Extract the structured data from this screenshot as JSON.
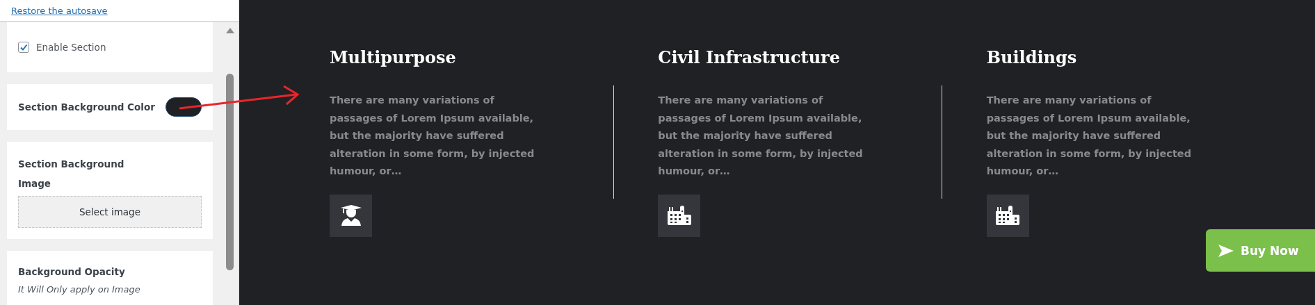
{
  "sidebar": {
    "restore_link": "Restore the autosave",
    "enable_section": {
      "label": "Enable Section",
      "checked": true
    },
    "background_color": {
      "label": "Section Background Color",
      "color": "#202125"
    },
    "background_image": {
      "label": "Section Background Image",
      "button": "Select image"
    },
    "opacity": {
      "label": "Background Opacity",
      "hint": "It Will Only apply on Image"
    }
  },
  "annotation": {
    "kind": "arrow"
  },
  "features": [
    {
      "title": "Multipurpose",
      "text": "There are many variations of passages of Lorem Ipsum available, but the majority have suffered alteration in some form, by injected humour, or…",
      "kind": "graduate"
    },
    {
      "title": "Civil Infrastructure",
      "text": "There are many variations of passages of Lorem Ipsum available, but the majority have suffered alteration in some form, by injected humour, or…",
      "kind": "buildings"
    },
    {
      "title": "Buildings",
      "text": "There are many variations of passages of Lorem Ipsum available, but the majority have suffered alteration in some form, by injected humour, or…",
      "kind": "buildings"
    }
  ],
  "buy_button": "Buy Now"
}
